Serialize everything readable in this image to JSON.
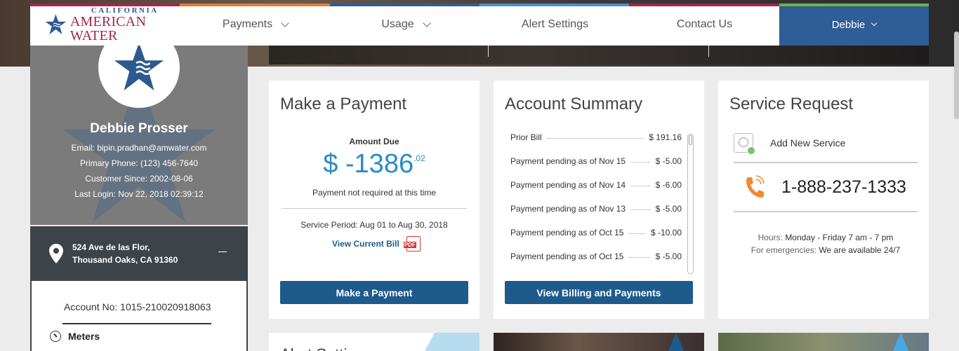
{
  "brand": {
    "line1": "CALIFORNIA",
    "line2": "AMERICAN WATER"
  },
  "nav": {
    "items": [
      {
        "label": "Payments",
        "has_dropdown": true
      },
      {
        "label": "Usage",
        "has_dropdown": true
      },
      {
        "label": "Alert Settings",
        "has_dropdown": false
      },
      {
        "label": "Contact Us",
        "has_dropdown": false
      }
    ],
    "user_label": "Debbie"
  },
  "colors": {
    "brand_blue": "#2f5d95",
    "button_blue": "#1e5b8c",
    "amount_blue": "#2a8bc7",
    "brand_red": "#a6244f"
  },
  "profile": {
    "name": "Debbie Prosser",
    "email": "Email: bipin.pradhan@amwater.com",
    "phone": "Primary Phone: (123) 456-7640",
    "customer_since": "Customer Since: 2002-08-06",
    "last_login": "Last Login: Nov 22, 2018 02:39:12"
  },
  "address": {
    "line1": "524 Ave de las Flor,",
    "line2": "Thousand Oaks, CA 91360"
  },
  "account": {
    "number": "Account No: 1015-210020918063",
    "meters_label": "Meters"
  },
  "payment_card": {
    "title": "Make a Payment",
    "amount_label": "Amount Due",
    "amount_main": "$ -1386",
    "amount_cents": ".02",
    "note": "Payment not required at this time",
    "service_period": "Service Period: Aug 01 to Aug 30, 2018",
    "view_bill": "View Current Bill",
    "pdf_label": "PDF",
    "button": "Make a Payment"
  },
  "summary_card": {
    "title": "Account Summary",
    "rows": [
      {
        "label": "Prior Bill",
        "value": "$ 191.16"
      },
      {
        "label": "Payment pending as of Nov 15",
        "value": "$ -5.00"
      },
      {
        "label": "Payment pending as of Nov 14",
        "value": "$ -6.00"
      },
      {
        "label": "Payment pending as of Nov 13",
        "value": "$ -5.00"
      },
      {
        "label": "Payment pending as of Oct 15",
        "value": "$ -10.00"
      },
      {
        "label": "Payment pending as of Oct 15",
        "value": "$ -5.00"
      }
    ],
    "button": "View Billing and Payments"
  },
  "service_card": {
    "title": "Service Request",
    "add_service": "Add New Service",
    "phone": "1-888-237-1333",
    "hours_label": "Hours:",
    "hours_value": "Monday - Friday 7 am - 7 pm",
    "emergency_label": "For emergencies:",
    "emergency_value": "We are available 24/7"
  },
  "bottom_cards": {
    "first_title": "Alert Setti"
  }
}
